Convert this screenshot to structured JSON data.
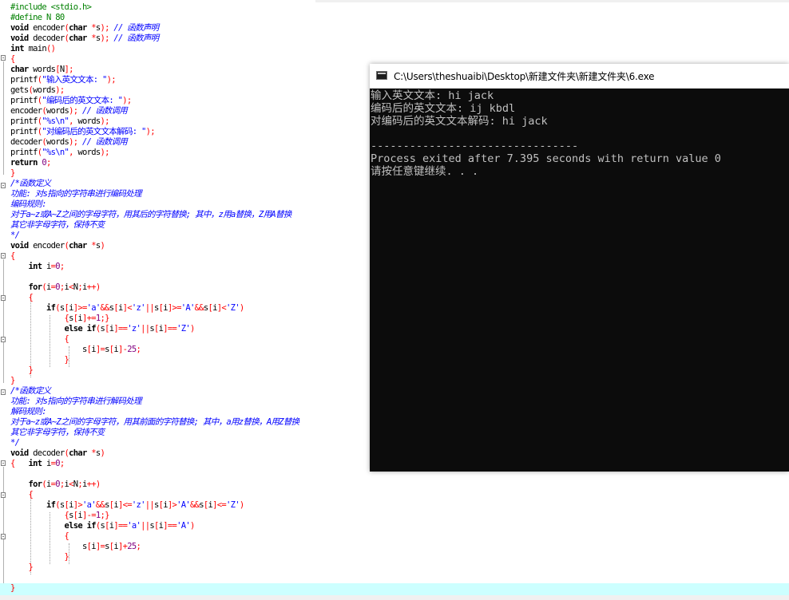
{
  "editor": {
    "lines": [
      "#include <stdio.h>",
      "#define N 80",
      "void encoder(char *s); // 函数声明",
      "void decoder(char *s); // 函数声明",
      "int main()",
      "{",
      "char words[N];",
      "printf(\"输入英文文本: \");",
      "gets(words);",
      "printf(\"编码后的英文文本: \");",
      "encoder(words); // 函数调用",
      "printf(\"%s\\n\", words);",
      "printf(\"对编码后的英文文本解码: \");",
      "decoder(words); // 函数调用",
      "printf(\"%s\\n\", words);",
      "return 0;",
      "}",
      "/*函数定义",
      "功能: 对s指向的字符串进行编码处理",
      "编码规则:",
      "对于a~z或A~Z之间的字母字符，用其后的字符替换; 其中，z用a替换，Z用A替换",
      "其它非字母字符，保持不变",
      "*/",
      "void encoder(char *s)",
      "{",
      "    int i=0;",
      "",
      "    for(i=0;i<N;i++)",
      "    {",
      "        if(s[i]>='a'&&s[i]<'z'||s[i]>='A'&&s[i]<'Z')",
      "            {s[i]+=1;}",
      "            else if(s[i]=='z'||s[i]=='Z')",
      "            {",
      "                s[i]=s[i]-25;",
      "            }",
      "    }",
      "}",
      "/*函数定义",
      "功能: 对s指向的字符串进行解码处理",
      "解码规则:",
      "对于a~z或A~Z之间的字母字符，用其前面的字符替换; 其中，a用z替换，A用Z替换",
      "其它非字母字符，保持不变",
      "*/",
      "void decoder(char *s)",
      "{   int i=0;",
      "",
      "    for(i=0;i<N;i++)",
      "    {",
      "        if(s[i]>'a'&&s[i]<='z'||s[i]>'A'&&s[i]<='Z')",
      "            {s[i]-=1;}",
      "            else if(s[i]=='a'||s[i]=='A')",
      "            {",
      "                s[i]=s[i]+25;",
      "            }",
      "    }",
      "",
      "}"
    ]
  },
  "console": {
    "title": "C:\\Users\\theshuaibi\\Desktop\\新建文件夹\\新建文件夹\\6.exe",
    "output": [
      "输入英文文本: hi jack",
      "编码后的英文文本: ij kbdl",
      "对编码后的英文文本解码: hi jack",
      "",
      "--------------------------------",
      "Process exited after 7.395 seconds with return value 0",
      "请按任意键继续. . ."
    ]
  }
}
